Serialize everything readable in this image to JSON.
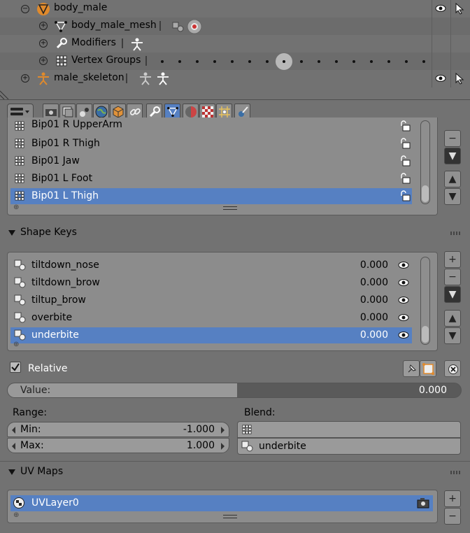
{
  "outliner": {
    "rows": [
      {
        "label": "body_male"
      },
      {
        "label": "body_male_mesh"
      },
      {
        "label": "Modifiers"
      },
      {
        "label": "Vertex Groups"
      },
      {
        "label": "male_skeleton"
      }
    ]
  },
  "vertex_groups": {
    "items": [
      {
        "label": "Bip01 R UpperArm"
      },
      {
        "label": "Bip01 R Thigh"
      },
      {
        "label": "Bip01 Jaw"
      },
      {
        "label": "Bip01 L Foot"
      },
      {
        "label": "Bip01 L Thigh"
      }
    ],
    "selected_index": 4
  },
  "shape_keys": {
    "title": "Shape Keys",
    "items": [
      {
        "label": "tiltdown_nose",
        "value": "0.000"
      },
      {
        "label": "tiltdown_brow",
        "value": "0.000"
      },
      {
        "label": "tiltup_brow",
        "value": "0.000"
      },
      {
        "label": "overbite",
        "value": "0.000"
      },
      {
        "label": "underbite",
        "value": "0.000"
      }
    ],
    "selected_index": 4,
    "relative_label": "Relative",
    "relative_checked": true,
    "value_label": "Value:",
    "value": "0.000",
    "range_label": "Range:",
    "min_label": "Min:",
    "min_value": "-1.000",
    "max_label": "Max:",
    "max_value": "1.000",
    "blend_label": "Blend:",
    "blend_vertex_group": "",
    "relative_key": "underbite"
  },
  "uv_maps": {
    "title": "UV Maps",
    "items": [
      {
        "label": "UVLayer0"
      }
    ]
  },
  "colors": {
    "selection": "#5680c2",
    "panel": "#727272",
    "list_bg": "#8c8c8c"
  }
}
